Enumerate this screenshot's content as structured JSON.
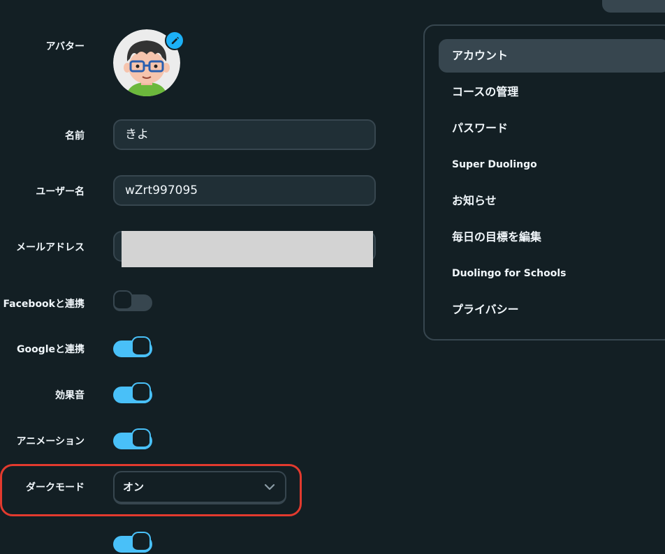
{
  "form": {
    "avatar_label": "アバター",
    "name_label": "名前",
    "name_value": "きよ",
    "username_label": "ユーザー名",
    "username_value": "wZrt997095",
    "email_label": "メールアドレス",
    "facebook_label": "Facebookと連携",
    "facebook_on": false,
    "google_label": "Googleと連携",
    "google_on": true,
    "sound_label": "効果音",
    "sound_on": true,
    "animation_label": "アニメーション",
    "animation_on": true,
    "darkmode_label": "ダークモード",
    "darkmode_value": "オン"
  },
  "sidebar": {
    "items": [
      {
        "label": "アカウント",
        "active": true
      },
      {
        "label": "コースの管理"
      },
      {
        "label": "パスワード"
      },
      {
        "label": "Super Duolingo"
      },
      {
        "label": "お知らせ"
      },
      {
        "label": "毎日の目標を編集"
      },
      {
        "label": "Duolingo for Schools"
      },
      {
        "label": "プライバシー"
      }
    ]
  },
  "colors": {
    "background": "#131f24",
    "accent": "#49c0f8",
    "border": "#37464f",
    "highlight": "#e23a2e"
  }
}
